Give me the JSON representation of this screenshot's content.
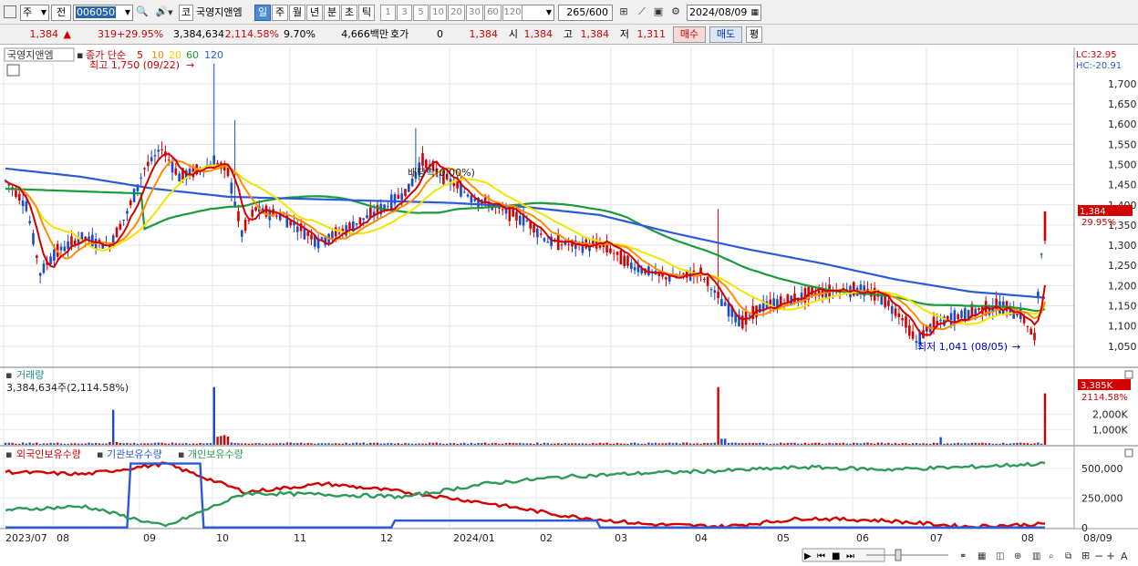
{
  "toolbar": {
    "market_type": "주",
    "prev_label": "전",
    "stock_code": "006050",
    "stock_type_label": "코",
    "stock_name": "국영지앤엠",
    "period_buttons": [
      "일",
      "주",
      "월",
      "년",
      "분",
      "초",
      "틱"
    ],
    "active_period": "일",
    "interval_buttons": [
      "1",
      "3",
      "5",
      "10",
      "20",
      "30",
      "60",
      "120"
    ],
    "count": "265",
    "count_total": "/600",
    "date": "2024/08/09"
  },
  "quote": {
    "price": "1,384",
    "change": "319",
    "change_pct": "+29.95%",
    "volume": "3,384,634",
    "volume_pct": "2,114.58%",
    "turnover": "9.70%",
    "amount": "4,666백만",
    "bid_label": "호가",
    "bid_value": "0",
    "bid_price": "1,384",
    "open_label": "시",
    "open": "1,384",
    "high_label": "고",
    "high": "1,384",
    "low_label": "저",
    "low": "1,311",
    "buy_label": "매수",
    "sell_label": "매도",
    "avg_label": "평"
  },
  "price_panel": {
    "name": "국영지앤엠",
    "legend_prefix": "종가 단순",
    "ma_labels": [
      "5",
      "10",
      "20",
      "60",
      "120"
    ],
    "high_annotation": "최고 1,750 (09/22)",
    "low_annotation": "최저 1,041 (08/05)",
    "dividend_annotation": "배당락(0.00%)",
    "lc_label": "LC:32.95",
    "hc_label": "HC:-20.91",
    "last_price_tag": "1,384",
    "last_pct_tag": "29.95%"
  },
  "volume_panel": {
    "title": "거래량",
    "value_label": "3,384,634주(2,114.58%)",
    "last_tag": "3,385K",
    "last_pct_tag": "2114.58%"
  },
  "holdings_panel": {
    "legend": [
      "외국인보유수량",
      "기관보유수량",
      "개인보유수량"
    ]
  },
  "x_axis_labels": [
    "2023/07",
    "08",
    "09",
    "10",
    "11",
    "12",
    "2024/01",
    "02",
    "03",
    "04",
    "05",
    "06",
    "07",
    "08",
    "08/09"
  ],
  "colors": {
    "ma5": "#d40000",
    "ma10": "#ff8c00",
    "ma20": "#f2e600",
    "ma60": "#1a9a3a",
    "ma120": "#2a5ad8",
    "up": "#d40000",
    "down": "#1a4bc8",
    "foreign": "#d40000",
    "institution": "#2a5ad8",
    "individual": "#2e9a5a"
  },
  "chart_data": [
    {
      "type": "candlestick",
      "title": "국영지앤엠",
      "y_ticks": [
        1050,
        1100,
        1150,
        1200,
        1250,
        1300,
        1350,
        1400,
        1450,
        1500,
        1550,
        1600,
        1650,
        1700
      ],
      "ylim": [
        1000,
        1790
      ],
      "x_months": [
        "2023/07",
        "08",
        "09",
        "10",
        "11",
        "12",
        "2024/01",
        "02",
        "03",
        "04",
        "05",
        "06",
        "07",
        "08"
      ],
      "ohlc_sample": [
        {
          "t": 0,
          "o": 1460,
          "h": 1470,
          "l": 1430,
          "c": 1440
        },
        {
          "t": 10,
          "o": 1330,
          "h": 1350,
          "l": 1200,
          "c": 1230
        },
        {
          "t": 35,
          "o": 1330,
          "h": 1400,
          "l": 1310,
          "c": 1380
        },
        {
          "t": 45,
          "o": 1500,
          "h": 1580,
          "l": 1480,
          "c": 1520
        },
        {
          "t": 60,
          "o": 1500,
          "h": 1750,
          "l": 1490,
          "c": 1510
        },
        {
          "t": 70,
          "o": 1380,
          "h": 1420,
          "l": 1300,
          "c": 1330
        },
        {
          "t": 100,
          "o": 1360,
          "h": 1400,
          "l": 1330,
          "c": 1380
        },
        {
          "t": 118,
          "o": 1480,
          "h": 1590,
          "l": 1470,
          "c": 1510
        },
        {
          "t": 140,
          "o": 1420,
          "h": 1440,
          "l": 1380,
          "c": 1390
        },
        {
          "t": 160,
          "o": 1310,
          "h": 1320,
          "l": 1280,
          "c": 1300
        },
        {
          "t": 180,
          "o": 1260,
          "h": 1290,
          "l": 1230,
          "c": 1240
        },
        {
          "t": 205,
          "o": 1220,
          "h": 1390,
          "l": 1150,
          "c": 1160
        },
        {
          "t": 225,
          "o": 1150,
          "h": 1170,
          "l": 1140,
          "c": 1160
        },
        {
          "t": 245,
          "o": 1200,
          "h": 1220,
          "l": 1180,
          "c": 1190
        },
        {
          "t": 262,
          "o": 1060,
          "h": 1090,
          "l": 1041,
          "c": 1070
        },
        {
          "t": 282,
          "o": 1140,
          "h": 1200,
          "l": 1120,
          "c": 1140
        },
        {
          "t": 298,
          "o": 1090,
          "h": 1120,
          "l": 1060,
          "c": 1065
        },
        {
          "t": 299,
          "o": 1311,
          "h": 1384,
          "l": 1311,
          "c": 1384
        }
      ],
      "high": {
        "value": 1750,
        "date": "09/22"
      },
      "low": {
        "value": 1041,
        "date": "08/05"
      },
      "ma120_approx": [
        1490,
        1470,
        1440,
        1420,
        1415,
        1410,
        1405,
        1395,
        1375,
        1330,
        1290,
        1255,
        1215,
        1185,
        1170
      ]
    },
    {
      "type": "bar",
      "title": "거래량",
      "y_ticks": [
        "1,000K",
        "2,000K"
      ],
      "last_value": 3384634,
      "spikes": [
        {
          "month": "08",
          "value": 2300000
        },
        {
          "month": "09",
          "value": 3800000
        },
        {
          "month": "04",
          "value": 3800000
        },
        {
          "month": "2024/08",
          "value": 3384634
        }
      ]
    },
    {
      "type": "line",
      "title": "보유수량",
      "y_ticks": [
        "0",
        "250,000",
        "500,000"
      ],
      "series": [
        {
          "name": "외국인보유수량",
          "approx": [
            470000,
            450000,
            540000,
            300000,
            370000,
            300000,
            210000,
            100000,
            30000,
            10000,
            80000,
            60000,
            10000,
            30000
          ]
        },
        {
          "name": "기관보유수량",
          "approx": [
            0,
            0,
            540000,
            0,
            0,
            0,
            60000,
            60000,
            0,
            0,
            0,
            0,
            0,
            0
          ]
        },
        {
          "name": "개인보유수량",
          "approx": [
            150000,
            180000,
            10000,
            290000,
            280000,
            260000,
            370000,
            430000,
            460000,
            480000,
            510000,
            490000,
            510000,
            540000
          ]
        }
      ]
    }
  ]
}
